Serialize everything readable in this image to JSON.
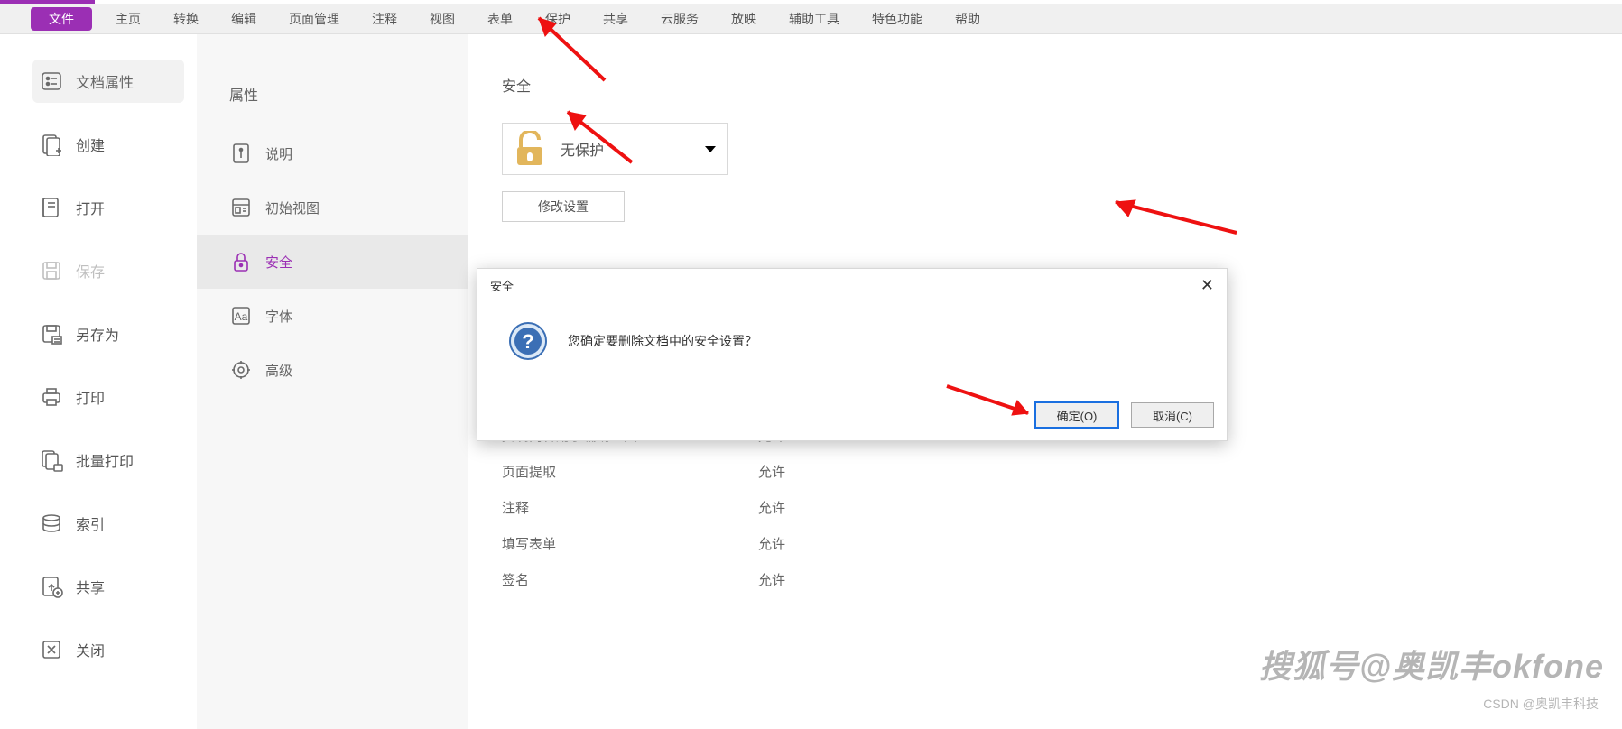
{
  "menubar": {
    "items": [
      "文件",
      "主页",
      "转换",
      "编辑",
      "页面管理",
      "注释",
      "视图",
      "表单",
      "保护",
      "共享",
      "云服务",
      "放映",
      "辅助工具",
      "特色功能",
      "帮助"
    ],
    "active_index": 0
  },
  "sidebar1": {
    "items": [
      {
        "label": "文档属性",
        "icon": "document-properties-icon",
        "active": true,
        "disabled": false
      },
      {
        "label": "创建",
        "icon": "create-icon",
        "active": false,
        "disabled": false
      },
      {
        "label": "打开",
        "icon": "open-icon",
        "active": false,
        "disabled": false
      },
      {
        "label": "保存",
        "icon": "save-icon",
        "active": false,
        "disabled": true
      },
      {
        "label": "另存为",
        "icon": "save-as-icon",
        "active": false,
        "disabled": false
      },
      {
        "label": "打印",
        "icon": "print-icon",
        "active": false,
        "disabled": false
      },
      {
        "label": "批量打印",
        "icon": "batch-print-icon",
        "active": false,
        "disabled": false
      },
      {
        "label": "索引",
        "icon": "index-icon",
        "active": false,
        "disabled": false
      },
      {
        "label": "共享",
        "icon": "share-icon",
        "active": false,
        "disabled": false
      },
      {
        "label": "关闭",
        "icon": "close-icon",
        "active": false,
        "disabled": false
      }
    ]
  },
  "sidebar2": {
    "title": "属性",
    "items": [
      {
        "label": "说明",
        "icon": "description-icon",
        "active": false
      },
      {
        "label": "初始视图",
        "icon": "initial-view-icon",
        "active": false
      },
      {
        "label": "安全",
        "icon": "security-icon",
        "active": true
      },
      {
        "label": "字体",
        "icon": "font-icon",
        "active": false
      },
      {
        "label": "高级",
        "icon": "advanced-icon",
        "active": false
      }
    ]
  },
  "main": {
    "title": "安全",
    "protection_select": "无保护",
    "modify_button": "修改设置",
    "permissions": [
      {
        "label": "复制内容用于辅助工具",
        "value": "允许"
      },
      {
        "label": "页面提取",
        "value": "允许"
      },
      {
        "label": "注释",
        "value": "允许"
      },
      {
        "label": "填写表单",
        "value": "允许"
      },
      {
        "label": "签名",
        "value": "允许"
      }
    ]
  },
  "dialog": {
    "title": "安全",
    "message": "您确定要删除文档中的安全设置？",
    "ok": "确定(O)",
    "cancel": "取消(C)"
  },
  "watermark": {
    "main": "搜狐号@奥凯丰okfone",
    "sub": "CSDN @奥凯丰科技"
  }
}
